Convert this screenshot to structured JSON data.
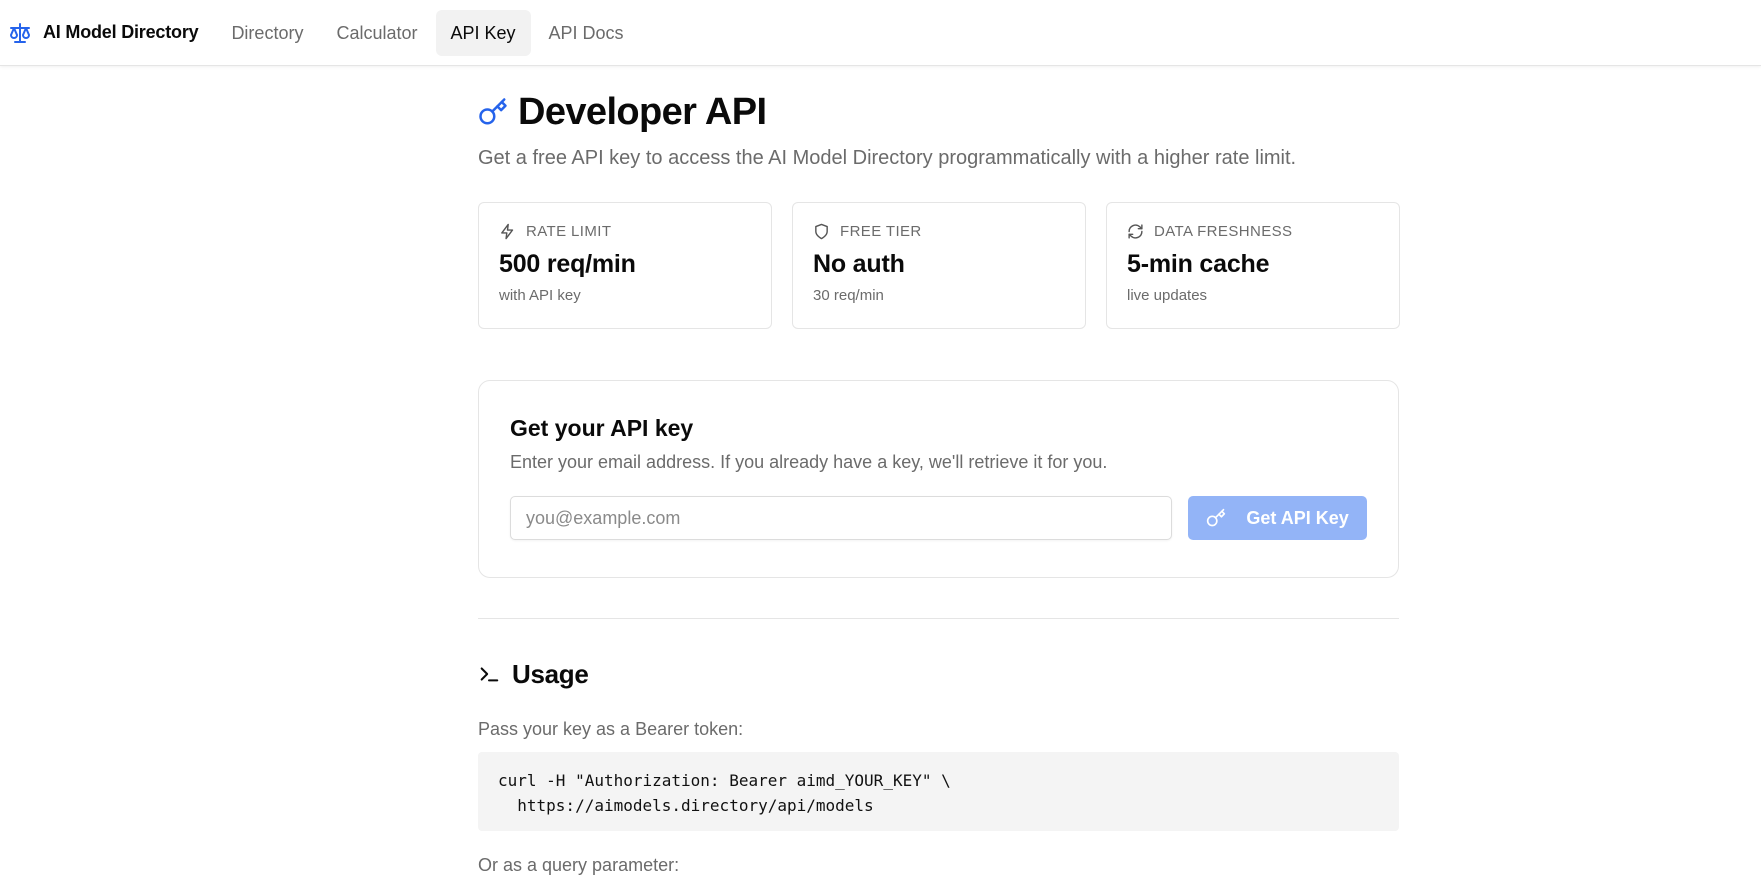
{
  "brand": {
    "name": "AI Model Directory",
    "icon": "scale-icon",
    "accent": "#2563eb"
  },
  "nav": [
    {
      "label": "Directory",
      "active": false
    },
    {
      "label": "Calculator",
      "active": false
    },
    {
      "label": "API Key",
      "active": true
    },
    {
      "label": "API Docs",
      "active": false
    }
  ],
  "header": {
    "title": "Developer API",
    "subtitle": "Get a free API key to access the AI Model Directory programmatically with a higher rate limit."
  },
  "stats": [
    {
      "label": "RATE LIMIT",
      "value": "500 req/min",
      "sub": "with API key",
      "icon": "lightning-icon"
    },
    {
      "label": "FREE TIER",
      "value": "No auth",
      "sub": "30 req/min",
      "icon": "shield-icon"
    },
    {
      "label": "DATA FRESHNESS",
      "value": "5-min cache",
      "sub": "live updates",
      "icon": "refresh-icon"
    }
  ],
  "key_card": {
    "title": "Get your API key",
    "description": "Enter your email address. If you already have a key, we'll retrieve it for you.",
    "email_placeholder": "you@example.com",
    "email_value": "",
    "button_label": "Get API Key",
    "button_color": "#93b4f7"
  },
  "usage": {
    "title": "Usage",
    "bearer_text": "Pass your key as a Bearer token:",
    "bearer_code": "curl -H \"Authorization: Bearer aimd_YOUR_KEY\" \\\n  https://aimodels.directory/api/models",
    "query_text": "Or as a query parameter:"
  }
}
